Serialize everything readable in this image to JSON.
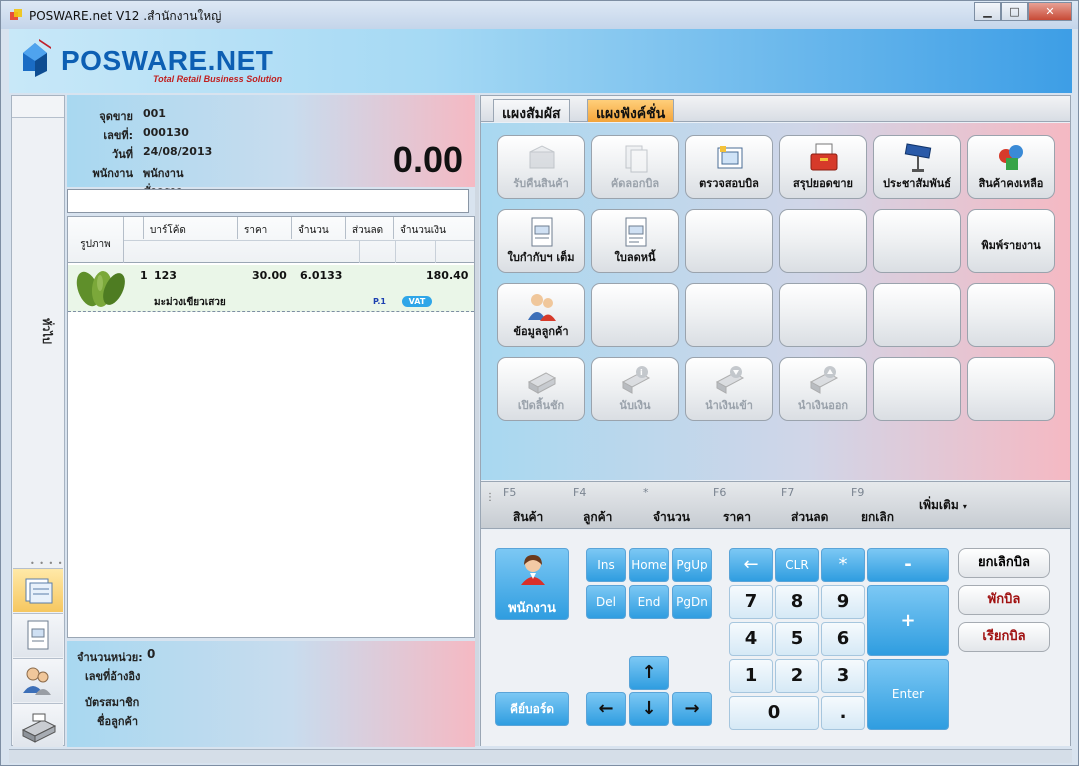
{
  "window": {
    "title": "POSWARE.net V12  .สำนักงานใหญ่",
    "controls": [
      "minimize",
      "maximize",
      "close"
    ]
  },
  "brand": {
    "name": "POSWARE.NET",
    "tagline": "Total Retail Business Solution"
  },
  "left_strip": {
    "vertical_label": "ทั่วไป",
    "buttons": [
      "bill-list-icon",
      "document-icon",
      "customers-icon",
      "cash-drawer-icon"
    ]
  },
  "sale_info": {
    "register_label": "จุดขาย",
    "register": "001",
    "number_label": "เลขที่:",
    "number": "000130",
    "date_label": "วันที่",
    "date": "24/08/2013",
    "staff_label": "พนักงาน",
    "staff": "พนักงานชั่วคราว",
    "total": "0.00"
  },
  "grid": {
    "columns": {
      "photo": "รูปภาพ",
      "barcode": "บาร์โค้ด",
      "price": "ราคา",
      "qty": "จำนวน",
      "discount": "ส่วนลด",
      "amount": "จำนวนเงิน"
    },
    "rows": [
      {
        "index": "1",
        "barcode": "123",
        "price": "30.00",
        "qty": "6.0133",
        "amount": "180.40",
        "name": "มะม่วงเขียวเสวย",
        "price_level": "P.1",
        "tax": "VAT"
      }
    ]
  },
  "footer_info": {
    "unit_count_label": "จำนวนหน่วย:",
    "unit_count": "0",
    "reference_label": "เลขที่อ้างอิง",
    "member_label": "บัตรสมาชิก",
    "customer_label": "ชื่อลูกค้า"
  },
  "tabs": [
    "แผงสัมผัส",
    "แผงฟังค์ชั่น"
  ],
  "function_buttons": [
    {
      "label": "รับคืนสินค้า",
      "icon": "return-goods-icon",
      "enabled": false
    },
    {
      "label": "คัดลอกบิล",
      "icon": "copy-bill-icon",
      "enabled": false
    },
    {
      "label": "ตรวจสอบบิล",
      "icon": "check-bill-icon",
      "enabled": true
    },
    {
      "label": "สรุปยอดขาย",
      "icon": "sales-summary-icon",
      "enabled": true
    },
    {
      "label": "ประชาสัมพันธ์",
      "icon": "pole-display-icon",
      "enabled": true
    },
    {
      "label": "สินค้าคงเหลือ",
      "icon": "inventory-icon",
      "enabled": true
    },
    {
      "label": "ใบกำกับฯ เต็ม",
      "icon": "tax-invoice-icon",
      "enabled": true
    },
    {
      "label": "ใบลดหนี้",
      "icon": "credit-note-icon",
      "enabled": true
    },
    {
      "label": "",
      "icon": "",
      "enabled": true
    },
    {
      "label": "",
      "icon": "",
      "enabled": true
    },
    {
      "label": "",
      "icon": "",
      "enabled": true
    },
    {
      "label": "พิมพ์รายงาน",
      "icon": "",
      "enabled": true
    },
    {
      "label": "ข้อมูลลูกค้า",
      "icon": "customer-info-icon",
      "enabled": true
    },
    {
      "label": "",
      "icon": "",
      "enabled": true
    },
    {
      "label": "",
      "icon": "",
      "enabled": true
    },
    {
      "label": "",
      "icon": "",
      "enabled": true
    },
    {
      "label": "",
      "icon": "",
      "enabled": true
    },
    {
      "label": "",
      "icon": "",
      "enabled": true
    },
    {
      "label": "เปิดลิ้นชัก",
      "icon": "open-drawer-icon",
      "enabled": false
    },
    {
      "label": "นับเงิน",
      "icon": "count-cash-icon",
      "enabled": false
    },
    {
      "label": "นำเงินเข้า",
      "icon": "cash-in-icon",
      "enabled": false
    },
    {
      "label": "นำเงินออก",
      "icon": "cash-out-icon",
      "enabled": false
    },
    {
      "label": "",
      "icon": "",
      "enabled": true
    },
    {
      "label": "",
      "icon": "",
      "enabled": true
    }
  ],
  "fkeys": [
    {
      "key": "F5",
      "label": "สินค้า"
    },
    {
      "key": "F4",
      "label": "ลูกค้า"
    },
    {
      "key": "*",
      "label": "จำนวน"
    },
    {
      "key": "F6",
      "label": "ราคา"
    },
    {
      "key": "F7",
      "label": "ส่วนลด"
    },
    {
      "key": "F9",
      "label": "ยกเลิก"
    }
  ],
  "more_label": "เพิ่มเติม",
  "keypad": {
    "staff": "พนักงาน",
    "keyboard": "คีย์บอร์ด",
    "nav": {
      "ins": "Ins",
      "home": "Home",
      "pgup": "PgUp",
      "del": "Del",
      "end": "End",
      "pgdn": "PgDn"
    },
    "arrows": {
      "up": "↑",
      "left": "←",
      "down": "↓",
      "right": "→"
    },
    "top": {
      "back": "←",
      "clr": "CLR",
      "star": "*",
      "minus": "-",
      "plus": "+",
      "enter": "Enter"
    },
    "digits": [
      "7",
      "8",
      "9",
      "4",
      "5",
      "6",
      "1",
      "2",
      "3",
      "0",
      "."
    ]
  },
  "actions": {
    "cancel_bill": "ยกเลิกบิล",
    "hold_bill": "พักบิล",
    "recall_bill": "เรียกบิล"
  },
  "colors": {
    "accent_blue": "#2f9de0",
    "hold_red": "#a01010",
    "active_tab": "#f4a43a"
  }
}
